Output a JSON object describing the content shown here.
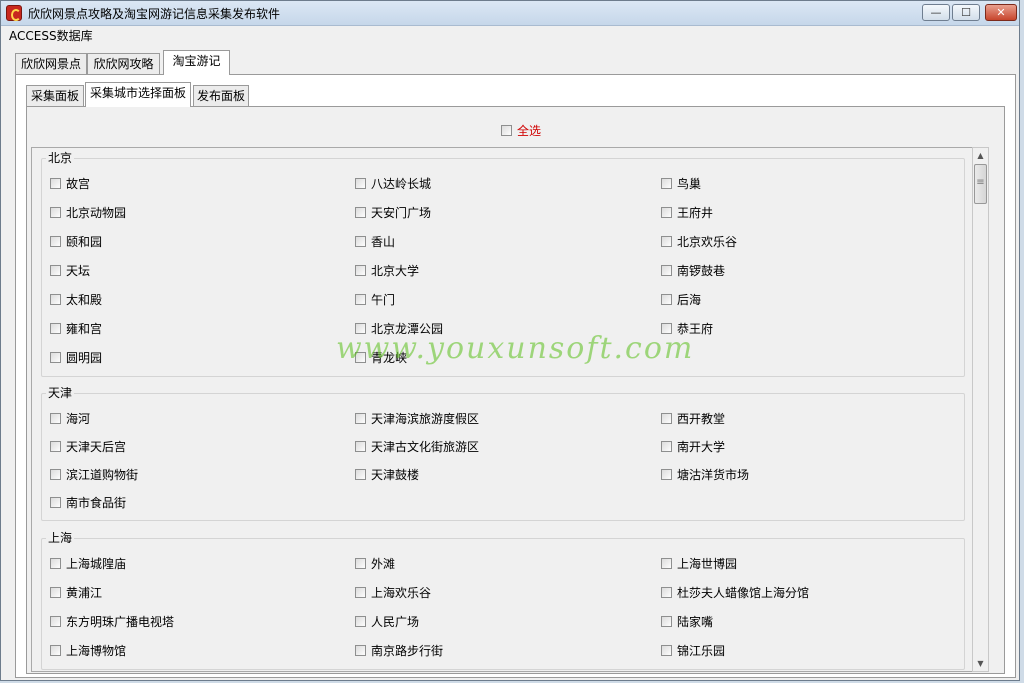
{
  "window": {
    "title": "欣欣网景点攻略及淘宝网游记信息采集发布软件",
    "controls": {
      "minimize": "—",
      "maximize": "☐",
      "close": "✕"
    }
  },
  "menu": {
    "database": "ACCESS数据库"
  },
  "tabs": [
    {
      "label": "欣欣网景点",
      "active": false
    },
    {
      "label": "欣欣网攻略",
      "active": false
    },
    {
      "label": "淘宝游记",
      "active": true
    }
  ],
  "subtabs": [
    {
      "label": "采集面板",
      "active": false
    },
    {
      "label": "采集城市选择面板",
      "active": true
    },
    {
      "label": "发布面板",
      "active": false
    }
  ],
  "select_all": {
    "label": "全选",
    "checked": false
  },
  "groups": [
    {
      "title": "北京",
      "items": [
        "故宫",
        "八达岭长城",
        "鸟巢",
        "北京动物园",
        "天安门广场",
        "王府井",
        "颐和园",
        "香山",
        "北京欢乐谷",
        "天坛",
        "北京大学",
        "南锣鼓巷",
        "太和殿",
        "午门",
        "后海",
        "雍和宫",
        "北京龙潭公园",
        "恭王府",
        "圆明园",
        "青龙峡"
      ]
    },
    {
      "title": "天津",
      "items": [
        "海河",
        "天津海滨旅游度假区",
        "西开教堂",
        "天津天后宫",
        "天津古文化街旅游区",
        "南开大学",
        "滨江道购物街",
        "天津鼓楼",
        "塘沽洋货市场",
        "南市食品街"
      ]
    },
    {
      "title": "上海",
      "items": [
        "上海城隍庙",
        "外滩",
        "上海世博园",
        "黄浦江",
        "上海欢乐谷",
        "杜莎夫人蜡像馆上海分馆",
        "东方明珠广播电视塔",
        "人民广场",
        "陆家嘴",
        "上海博物馆",
        "南京路步行街",
        "锦江乐园"
      ]
    }
  ],
  "watermark": "www.youxunsoft.com",
  "scrollbar": {
    "up": "▲",
    "down": "▼"
  }
}
